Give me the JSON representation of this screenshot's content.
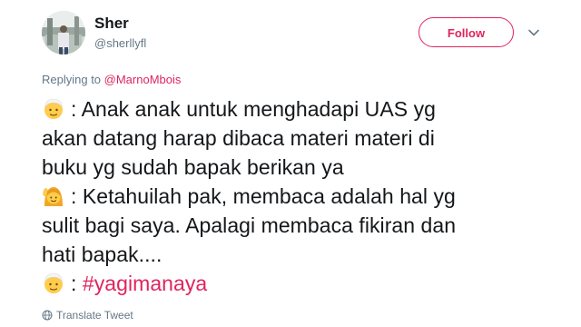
{
  "author": {
    "name": "Sher",
    "handle": "@sherllyfl"
  },
  "follow_label": "Follow",
  "reply": {
    "prefix": "Replying to ",
    "mention": "@MarnoMbois"
  },
  "tweet_lines": [
    ": Anak anak untuk menghadapi UAS yg",
    "akan datang harap dibaca materi materi di",
    "buku yg sudah bapak berikan ya",
    ": Ketahuilah pak, membaca adalah hal yg",
    "sulit bagi saya. Apalagi membaca fikiran dan",
    "hati bapak....",
    ": ",
    "#yagimanaya"
  ],
  "translate_label": "Translate Tweet",
  "colors": {
    "accent": "#e0245e",
    "secondary_text": "#657786",
    "primary_text": "#14171a"
  },
  "icons": {
    "teacher_emoji": "older-man-emoji-icon",
    "student_emoji": "woman-raising-hand-emoji-icon",
    "menu": "chevron-down-icon",
    "translate": "globe-icon"
  }
}
